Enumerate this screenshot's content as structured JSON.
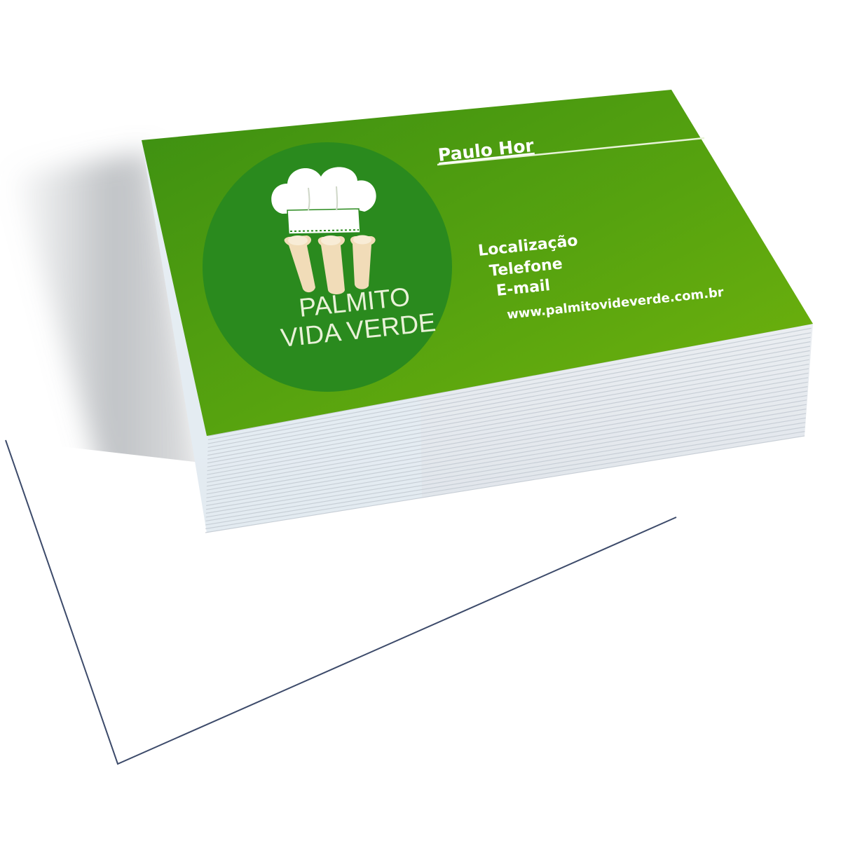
{
  "card": {
    "name": "Paulo Hor",
    "contact": {
      "location": "Localização",
      "phone": "Telefone",
      "email": "E-mail",
      "website": "www.palmitovideverde.com.br"
    }
  },
  "logo": {
    "line1": "PALMITO",
    "line2": "VIDA VERDE",
    "icon": "chef-hat-with-palm-hearts"
  },
  "colors": {
    "card_green": "#5fa80c",
    "card_green_dark": "#3f8a10",
    "logo_circle": "#2a8a1e",
    "palm_heart": "#f1dcb8",
    "background": "#ffffff"
  }
}
